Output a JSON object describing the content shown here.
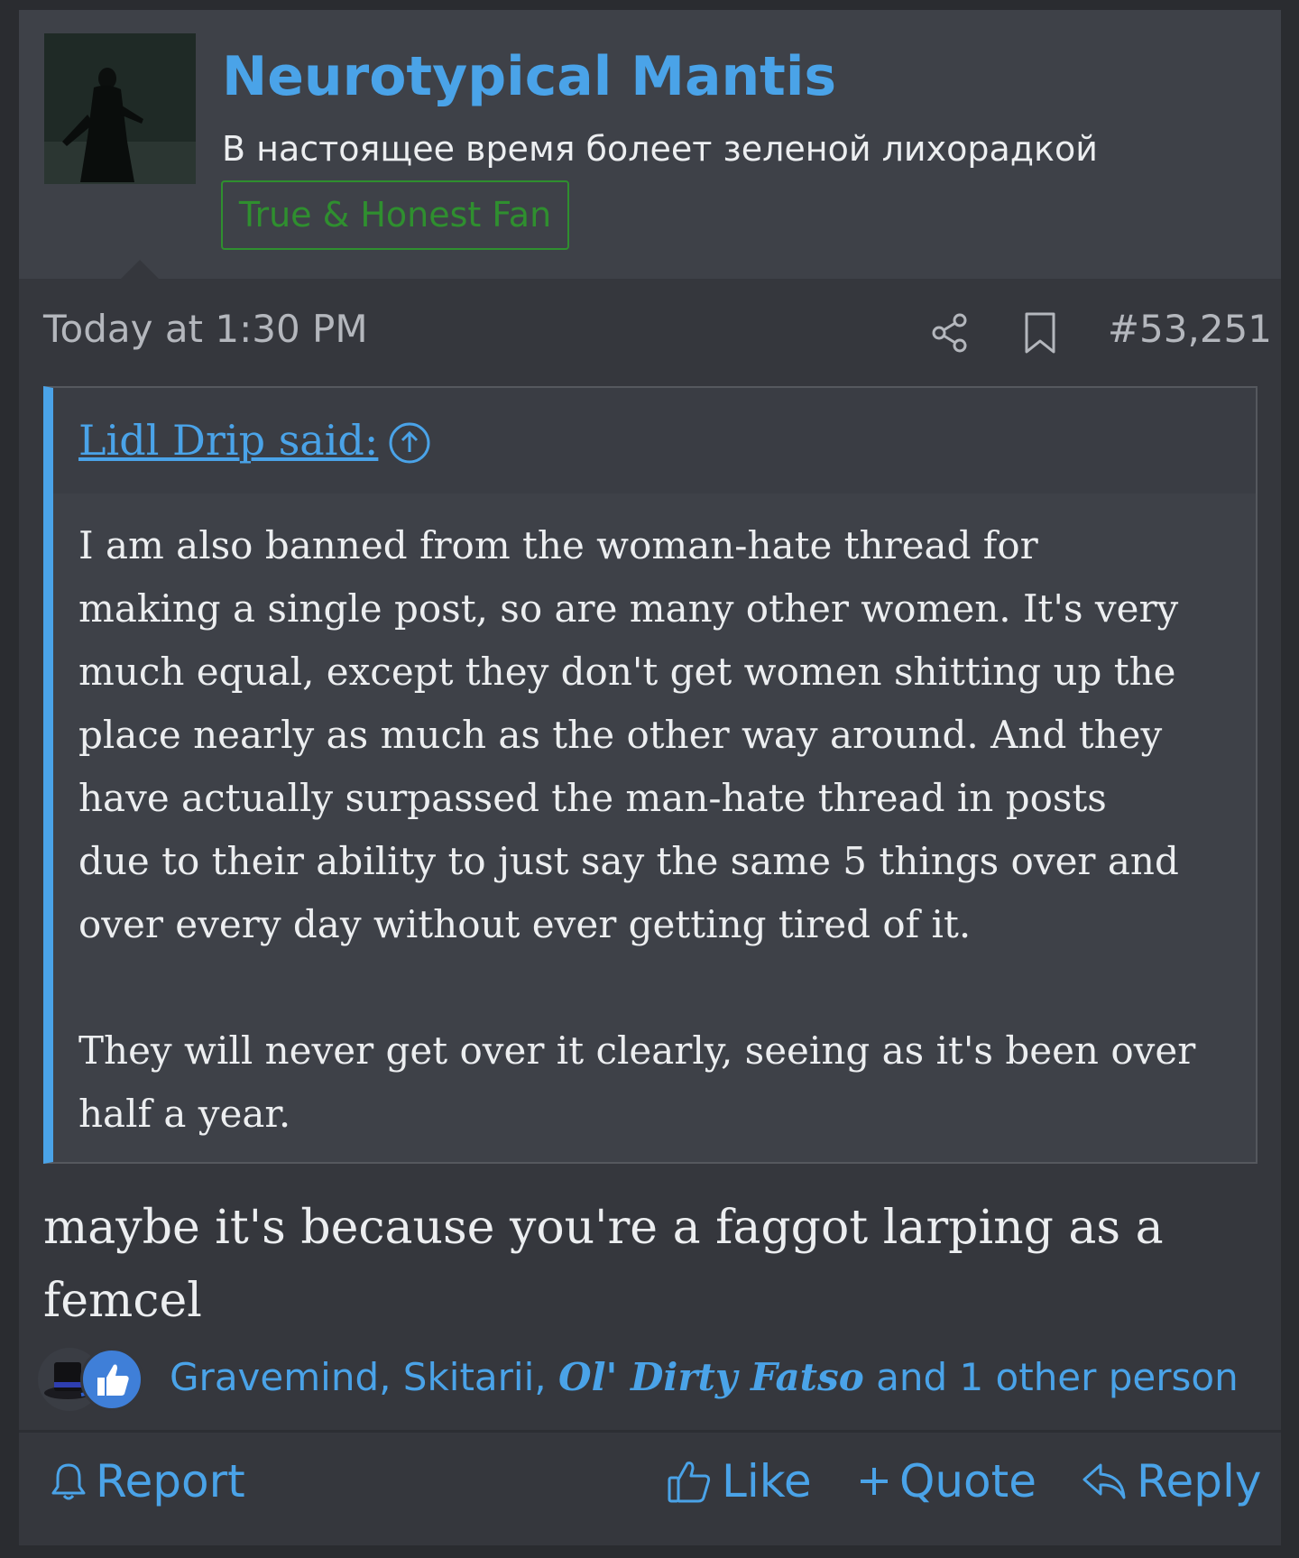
{
  "user": {
    "name": "Neurotypical Mantis",
    "title": "В настоящее время болеет зеленой лихорадкой",
    "banner": "True & Honest Fan"
  },
  "post": {
    "date": "Today at 1:30 PM",
    "number": "#53,251",
    "icons": [
      "share-icon",
      "bookmark-icon"
    ]
  },
  "quote": {
    "author": "Lidl Drip said:",
    "lines": [
      "I am also banned from the woman-hate thread for",
      "making a single post, so are many other women. It's very",
      "much equal, except they don't get women shitting up the",
      "place nearly as much as the other way around. And they",
      "have actually surpassed the man-hate thread in posts",
      "due to their ability to just say the same 5 things over and",
      "over every day without ever getting tired of it."
    ],
    "lines2": [
      "They will never get over it clearly, seeing as it's been over",
      "half a year."
    ]
  },
  "message": {
    "lines": [
      "maybe it's because you're a faggot larping as a",
      "femcel"
    ]
  },
  "reactions": {
    "names_plain": "Gravemind, Skitarii, ",
    "name_gothic": "Ol' Dirty Fatso",
    "suffix": " and 1 other person",
    "icons": [
      "top-hat-icon",
      "thumbs-up-icon"
    ]
  },
  "actions": {
    "report": "Report",
    "like": "Like",
    "quote": "Quote",
    "reply": "Reply"
  },
  "colors": {
    "accent": "#4aa3e8",
    "banner": "#2f8f2f",
    "background": "#35373d"
  }
}
